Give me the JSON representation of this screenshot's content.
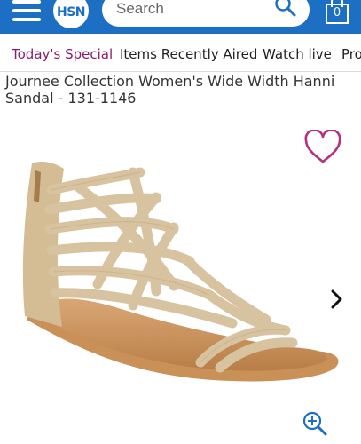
{
  "header": {
    "logo_text": "HSN",
    "search_placeholder": "Search",
    "bag_count": "0",
    "brand_color": "#1c6fc2"
  },
  "nav": {
    "items": [
      {
        "label": "Today's Special",
        "active": true
      },
      {
        "label": "Items Recently Aired",
        "active": false
      },
      {
        "label": "Watch live",
        "active": false
      },
      {
        "label": "Pro",
        "active": false
      }
    ],
    "active_color": "#8a1d6c"
  },
  "product": {
    "title": "Journee Collection Women's Wide Width Hanni Sandal  - 131-1146",
    "image_subject": "tan strappy gladiator sandal",
    "heart_color": "#b5307f"
  },
  "icons": [
    "menu-icon",
    "search-icon",
    "shopping-bag-icon",
    "heart-icon",
    "chevron-right-icon",
    "zoom-in-icon"
  ]
}
